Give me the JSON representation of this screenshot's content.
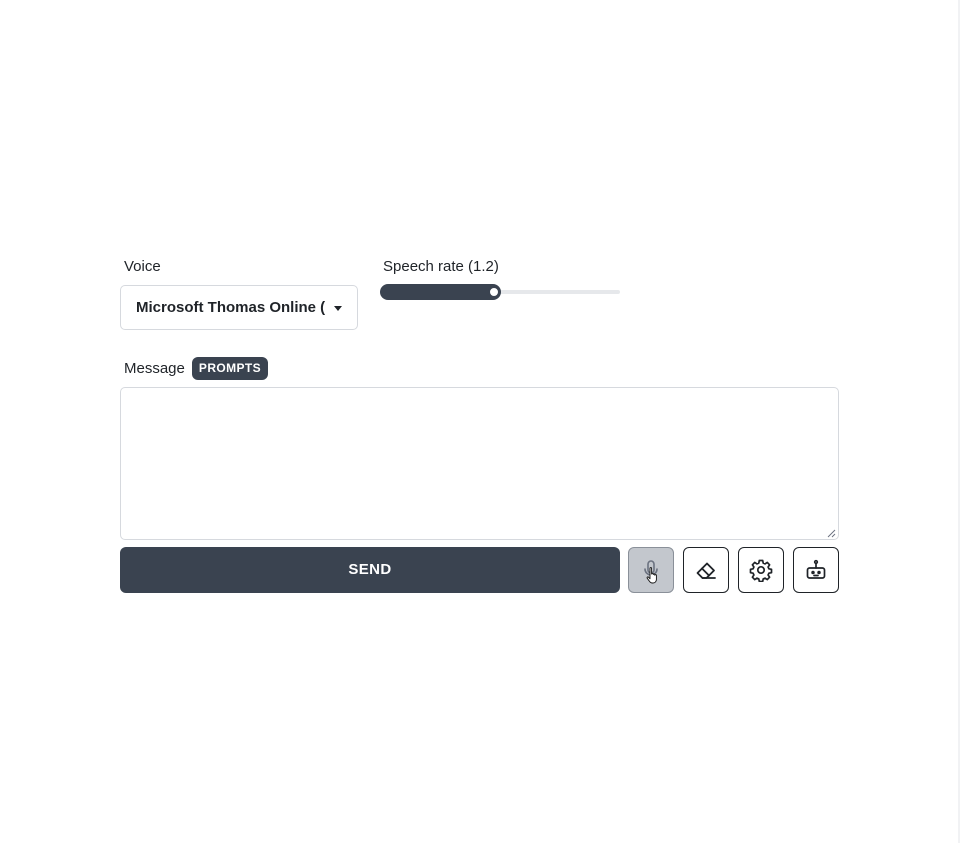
{
  "voice": {
    "label": "Voice",
    "selected": "Microsoft Thomas Online (N"
  },
  "speech_rate": {
    "label": "Speech rate (1.2)",
    "value": 1.2,
    "fraction": 0.47
  },
  "message": {
    "label": "Message",
    "prompts_badge": "PROMPTS",
    "value": ""
  },
  "actions": {
    "send_label": "SEND",
    "microphone_icon": "microphone-icon",
    "eraser_icon": "eraser-icon",
    "settings_icon": "gear-icon",
    "robot_icon": "robot-icon"
  },
  "colors": {
    "accent": "#3a4350",
    "border": "#d6d9de",
    "mic_active_bg": "#c3c7cd"
  }
}
